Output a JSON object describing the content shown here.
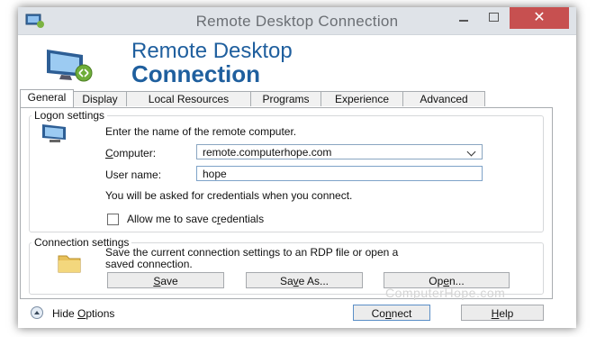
{
  "window": {
    "title": "Remote Desktop Connection",
    "close_glyph": "✕"
  },
  "banner": {
    "line1": "Remote Desktop",
    "line2": "Connection"
  },
  "tabs": [
    {
      "label": "General",
      "active": true
    },
    {
      "label": "Display",
      "active": false
    },
    {
      "label": "Local Resources",
      "active": false
    },
    {
      "label": "Programs",
      "active": false
    },
    {
      "label": "Experience",
      "active": false
    },
    {
      "label": "Advanced",
      "active": false
    }
  ],
  "logon": {
    "group_label": "Logon settings",
    "instruction": "Enter the name of the remote computer.",
    "computer_label_prefix": "",
    "computer_label_mnemonic": "C",
    "computer_label_rest": "omputer:",
    "computer_value": "remote.computerhope.com",
    "username_label": "User name:",
    "username_value": "hope",
    "credentials_note": "You will be asked for credentials when you connect.",
    "save_credentials_prefix": "Allow me to save c",
    "save_credentials_mnemonic": "r",
    "save_credentials_rest": "edentials",
    "save_credentials_checked": false
  },
  "connection": {
    "group_label": "Connection settings",
    "description_line1": "Save the current connection settings to an RDP file or open a",
    "description_line2": "saved connection.",
    "save_mnemonic": "S",
    "save_rest": "ave",
    "saveas_prefix": "Sa",
    "saveas_mnemonic": "v",
    "saveas_rest": "e As...",
    "open_prefix": "Op",
    "open_mnemonic": "e",
    "open_rest": "n..."
  },
  "watermark": "ComputerHope.com",
  "footer": {
    "hide_prefix": "Hide ",
    "hide_mnemonic": "O",
    "hide_rest": "ptions",
    "connect_prefix": "Co",
    "connect_mnemonic": "n",
    "connect_rest": "nect",
    "help_mnemonic": "H",
    "help_rest": "elp"
  },
  "colors": {
    "accent": "#1f5f9e",
    "close_button": "#c75050"
  },
  "icons": [
    "app-icon",
    "monitor-connection-icon",
    "monitor-icon",
    "folder-icon",
    "hide-options-icon"
  ]
}
